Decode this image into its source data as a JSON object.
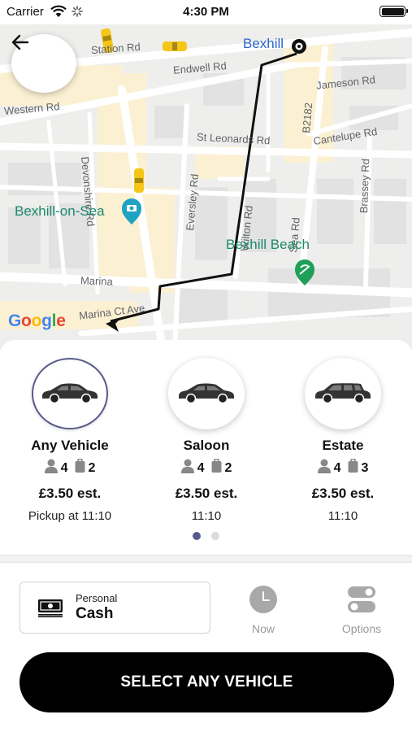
{
  "status_bar": {
    "carrier": "Carrier",
    "time": "4:30 PM"
  },
  "map": {
    "street_labels": {
      "station_rd": "Station Rd",
      "endwell_rd": "Endwell Rd",
      "jameson_rd": "Jameson Rd",
      "western_rd": "Western Rd",
      "st_leonards_rd": "St Leonards Rd",
      "cantelupe_rd": "Cantelupe Rd",
      "devonshire_rd": "Devonshire Rd",
      "eversley_rd": "Eversley Rd",
      "wilton_rd": "Wilton Rd",
      "sea_rd": "Sea Rd",
      "b2182": "B2182",
      "brassey_rd": "Brassey Rd",
      "marina": "Marina",
      "marina_ct_ave": "Marina Ct Ave"
    },
    "places": {
      "bexhill": "Bexhill",
      "bexhill_on_sea": "Bexhill-on-Sea",
      "bexhill_beach": "Bexhill Beach"
    },
    "google_logo": [
      "G",
      "o",
      "o",
      "g",
      "l",
      "e"
    ],
    "colors": {
      "route": "#111111",
      "taxi": "#f5c518",
      "poi_green": "#1a8a6a",
      "poi_blue": "#2a66c9"
    }
  },
  "vehicles": [
    {
      "name": "Any Vehicle",
      "passengers": "4",
      "luggage": "2",
      "price": "£3.50 est.",
      "pickup": "Pickup at 11:10",
      "selected": true,
      "icon": "sedan-icon"
    },
    {
      "name": "Saloon",
      "passengers": "4",
      "luggage": "2",
      "price": "£3.50 est.",
      "pickup": "11:10",
      "selected": false,
      "icon": "sedan-icon"
    },
    {
      "name": "Estate",
      "passengers": "4",
      "luggage": "3",
      "price": "£3.50 est.",
      "pickup": "11:10",
      "selected": false,
      "icon": "estate-car-icon"
    }
  ],
  "pagination": {
    "pages": 2,
    "current": 1
  },
  "payment": {
    "type": "Personal",
    "method": "Cash",
    "icon": "cash-icon"
  },
  "actions": {
    "now": "Now",
    "options": "Options"
  },
  "select_button": "SELECT ANY VEHICLE",
  "accent_color": "#595b8a"
}
